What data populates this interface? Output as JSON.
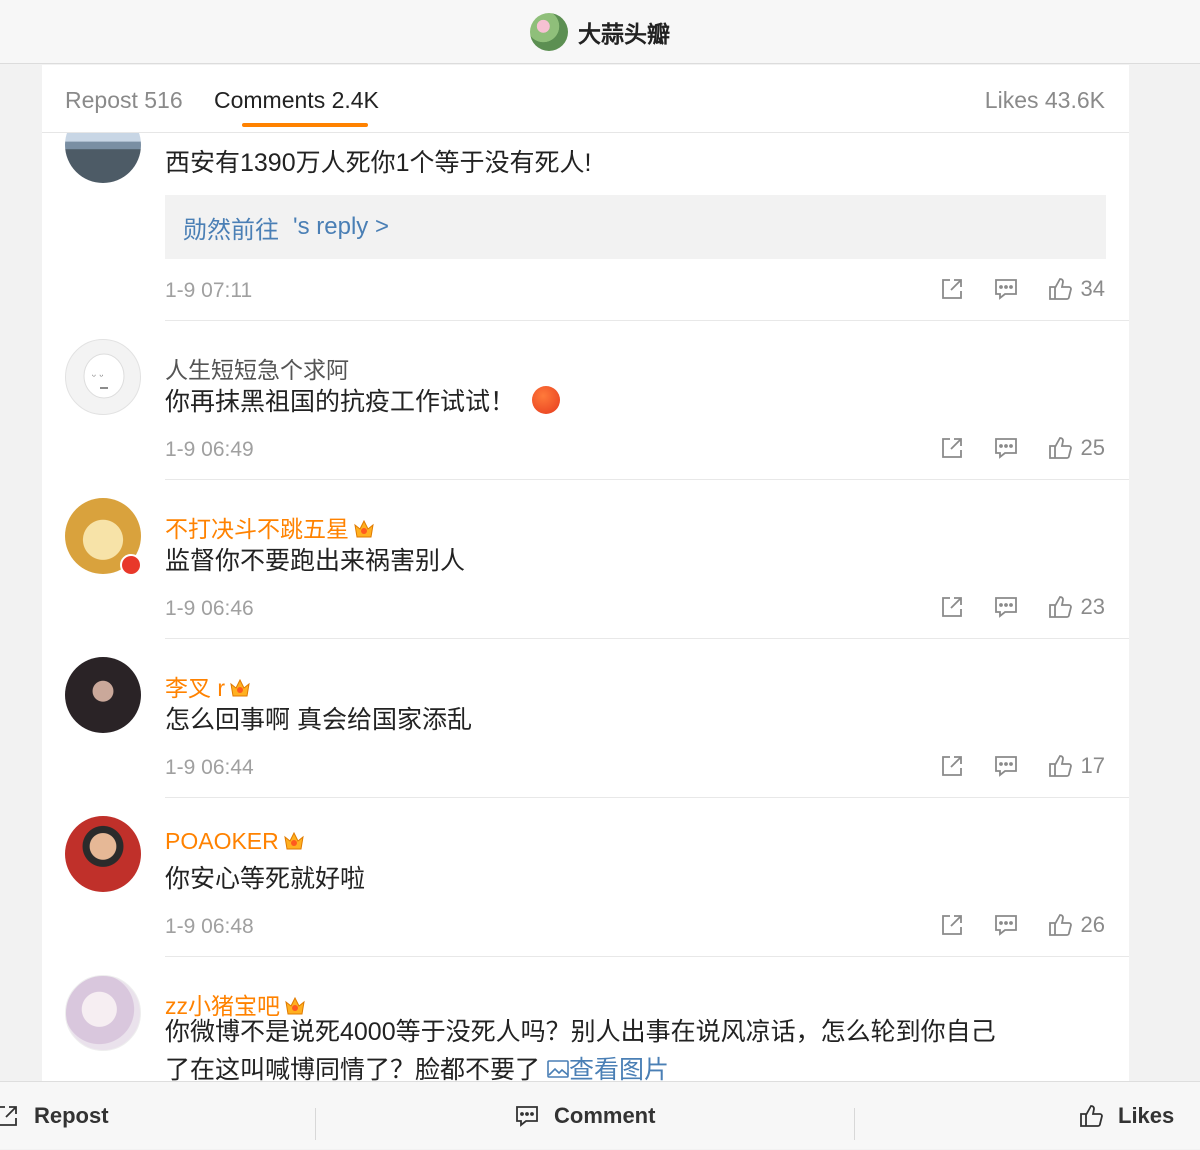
{
  "header": {
    "title": "大蒜头瓣"
  },
  "tabs": {
    "repost": "Repost 516",
    "comments": "Comments 2.4K",
    "likes": "Likes 43.6K"
  },
  "comments": [
    {
      "username": "",
      "text": "西安有1390万人死你1个等于没有死人!",
      "reply_name": "勋然前往",
      "reply_suffix": "'s reply >",
      "time": "1-9 07:11",
      "likes": "34"
    },
    {
      "username": "人生短短急个求阿",
      "text": "你再抹黑祖国的抗疫工作试试！",
      "time": "1-9 06:49",
      "likes": "25"
    },
    {
      "username": "不打决斗不跳五星",
      "text": "监督你不要跑出来祸害别人",
      "time": "1-9 06:46",
      "likes": "23"
    },
    {
      "username": "李叉 r",
      "text": "怎么回事啊 真会给国家添乱",
      "time": "1-9 06:44",
      "likes": "17"
    },
    {
      "username": "POAOKER",
      "text": "你安心等死就好啦",
      "time": "1-9 06:48",
      "likes": "26"
    },
    {
      "username": "zz小猪宝吧",
      "text_line1": "你微博不是说死4000等于没死人吗？别人出事在说风凉话，怎么轮到你自己",
      "text_line2": "了在这叫喊博同情了？脸都不要了",
      "image_link": "查看图片"
    }
  ],
  "bottom_bar": {
    "repost": "Repost",
    "comment": "Comment",
    "likes": "Likes"
  },
  "colors": {
    "accent": "#ff8200",
    "link": "#4a7fb5"
  }
}
